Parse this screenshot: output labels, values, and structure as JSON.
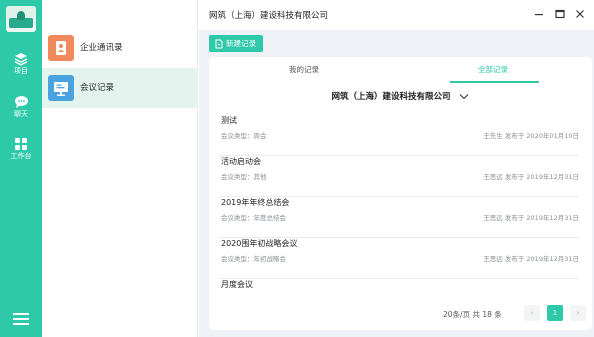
{
  "window": {
    "title": "网筑（上海）建设科技有限公司"
  },
  "rail": {
    "items": [
      {
        "label": "项目",
        "icon": "layers-icon"
      },
      {
        "label": "聊天",
        "icon": "chat-icon"
      },
      {
        "label": "工作台",
        "icon": "grid-icon"
      }
    ],
    "bottom_icon": "menu-icon"
  },
  "sidebar": {
    "items": [
      {
        "label": "企业通讯录",
        "icon": "contacts-icon",
        "color": "#f08a5c",
        "active": false
      },
      {
        "label": "会议记录",
        "icon": "meeting-icon",
        "color": "#4aa3df",
        "active": true
      }
    ]
  },
  "toolbar": {
    "new_record_label": "新建记录"
  },
  "tabs": [
    {
      "label": "我的记录",
      "active": false
    },
    {
      "label": "全部记录",
      "active": true
    }
  ],
  "company_select": {
    "value": "网筑（上海）建设科技有限公司"
  },
  "records": [
    {
      "title": "测试",
      "type": "会议类型：周会",
      "meta": "王先生  发布于 2020年01月10日"
    },
    {
      "title": "活动启动会",
      "type": "会议类型：其他",
      "meta": "王思远  发布于 2019年12月31日"
    },
    {
      "title": "2019年年终总结会",
      "type": "会议类型：年度总结会",
      "meta": "王思远  发布于 2019年12月31日"
    },
    {
      "title": "2020围年初战略会议",
      "type": "会议类型：年初战略会",
      "meta": "王思远  发布于 2019年12月31日"
    },
    {
      "title": "月度会议",
      "type": "",
      "meta": ""
    }
  ],
  "pagination": {
    "info": "20条/页   共 18 条",
    "prev": "‹",
    "current": "1",
    "next": "›"
  },
  "colors": {
    "accent": "#2ec9a9",
    "background": "#eef2f6"
  }
}
